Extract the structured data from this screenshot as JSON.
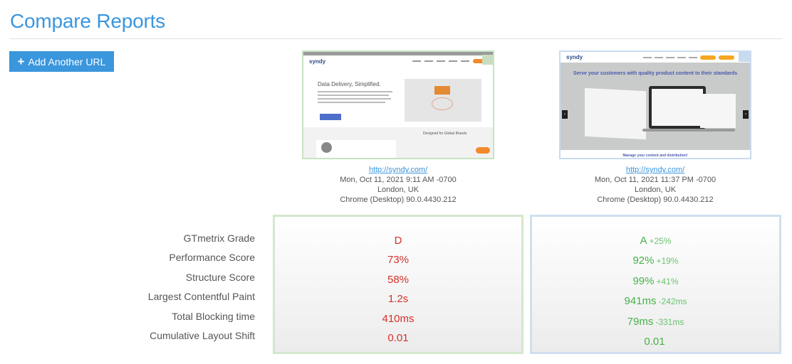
{
  "header": {
    "title": "Compare Reports"
  },
  "toolbar": {
    "add_url_label": "Add Another URL",
    "add_url_icon": "plus-icon"
  },
  "reports": [
    {
      "thumbnail": {
        "logo": "syndy",
        "hero_title": "Data Delivery, Simplified.",
        "brands_heading": "Designed for Global Brands"
      },
      "url": "http://syndy.com/",
      "date": "Mon, Oct 11, 2021 9:11 AM -0700",
      "location": "London, UK",
      "browser": "Chrome (Desktop) 90.0.4430.212",
      "accent": "#c8e3c2"
    },
    {
      "thumbnail": {
        "logo": "syndy",
        "hero_title": "Serve your customers with quality product content to their standards",
        "footer_text": "Manage your content and distribution!",
        "prev_arrow": "‹",
        "next_arrow": "›"
      },
      "url": "http://syndy.com/",
      "date": "Mon, Oct 11, 2021 11:37 PM -0700",
      "location": "London, UK",
      "browser": "Chrome (Desktop) 90.0.4430.212",
      "accent": "#c9dbef"
    }
  ],
  "metrics": {
    "labels": [
      "GTmetrix Grade",
      "Performance Score",
      "Structure Score",
      "Largest Contentful Paint",
      "Total Blocking time",
      "Cumulative Layout Shift"
    ],
    "report1": [
      {
        "value": "D",
        "delta": ""
      },
      {
        "value": "73%",
        "delta": ""
      },
      {
        "value": "58%",
        "delta": ""
      },
      {
        "value": "1.2s",
        "delta": ""
      },
      {
        "value": "410ms",
        "delta": ""
      },
      {
        "value": "0.01",
        "delta": ""
      }
    ],
    "report2": [
      {
        "value": "A",
        "delta": "+25%"
      },
      {
        "value": "92%",
        "delta": "+19%"
      },
      {
        "value": "99%",
        "delta": "+41%"
      },
      {
        "value": "941ms",
        "delta": "-242ms"
      },
      {
        "value": "79ms",
        "delta": "-331ms"
      },
      {
        "value": "0.01",
        "delta": ""
      }
    ]
  },
  "colors": {
    "brand": "#3a96dd",
    "bad": "#d6312a",
    "good": "#46b24a"
  }
}
